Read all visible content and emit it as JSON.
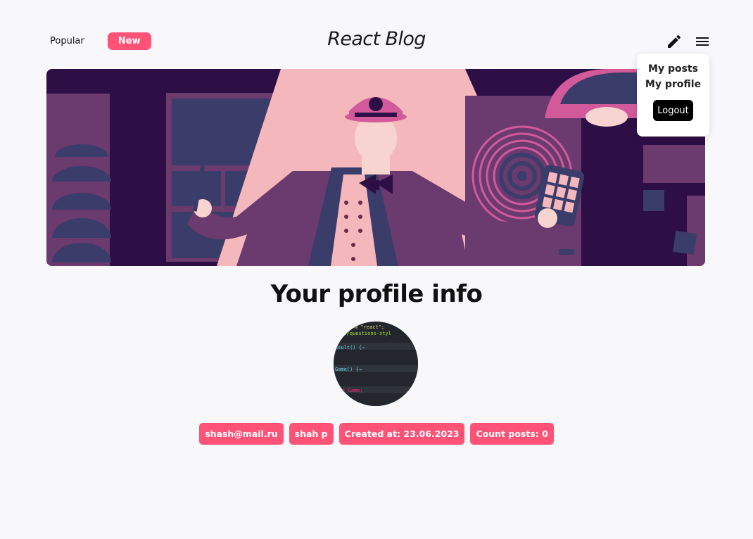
{
  "header": {
    "tabs": [
      {
        "label": "Popular",
        "active": false
      },
      {
        "label": "New",
        "active": true
      }
    ],
    "logo": "React Blog",
    "icons": {
      "create": "pencil-icon",
      "menu": "hamburger-menu-icon"
    }
  },
  "menu": {
    "items": [
      "My posts",
      "My profile"
    ],
    "logout_label": "Logout"
  },
  "banner": {
    "image": "designer-illustration"
  },
  "profile": {
    "title": "Your profile info",
    "avatar_code": [
      "m \"react\";",
      "les/questions-styl",
      "esult() {→",
      "Game() {→",
      "lt Game;"
    ],
    "chips": {
      "email": "shash@mail.ru",
      "name": "shah p",
      "created": "Created at: 23.06.2023",
      "count": "Count posts: 0"
    }
  },
  "colors": {
    "accent": "#ff5277",
    "dark": "#000000",
    "background": "#f8f8fb"
  }
}
